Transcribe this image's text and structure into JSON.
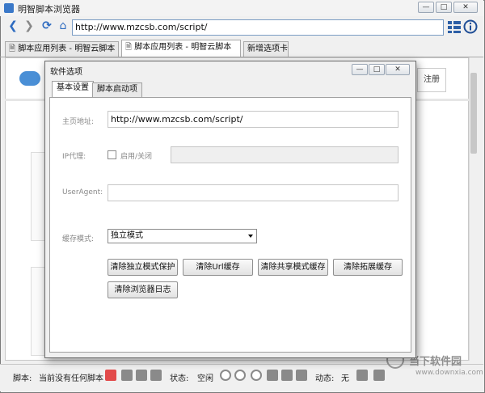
{
  "window": {
    "title": "明智脚本浏览器"
  },
  "toolbar": {
    "address": "http://www.mzcsb.com/script/"
  },
  "tabs": [
    {
      "label": "脚本应用列表 - 明智云脚本"
    },
    {
      "label": "脚本应用列表 - 明智云脚本"
    },
    {
      "label": "新增选项卡"
    }
  ],
  "page": {
    "register_label": "注册"
  },
  "dialog": {
    "title": "软件选项",
    "tabs": [
      {
        "label": "基本设置"
      },
      {
        "label": "脚本启动项"
      }
    ],
    "home_label": "主页地址:",
    "home_value": "http://www.mzcsb.com/script/",
    "proxy_label": "IP代理:",
    "proxy_toggle_label": "启用/关闭",
    "proxy_value": "",
    "ua_label": "UserAgent:",
    "ua_value": "",
    "cache_label": "缓存模式:",
    "cache_value": "独立模式",
    "buttons": {
      "clear_isolated": "清除独立模式保护",
      "clear_url": "清除Url缓存",
      "clear_shared": "清除共享模式缓存",
      "clear_ext": "清除拓展缓存",
      "clear_log": "清除浏览器日志"
    }
  },
  "statusbar": {
    "script_label": "脚本:",
    "script_value": "当前没有任何脚本",
    "state_label": "状态:",
    "state_value": "空闲",
    "dynamic_label": "动态:",
    "dynamic_value": "无"
  },
  "watermark": {
    "brand": "当下软件园",
    "url": "www.downxia.com"
  }
}
